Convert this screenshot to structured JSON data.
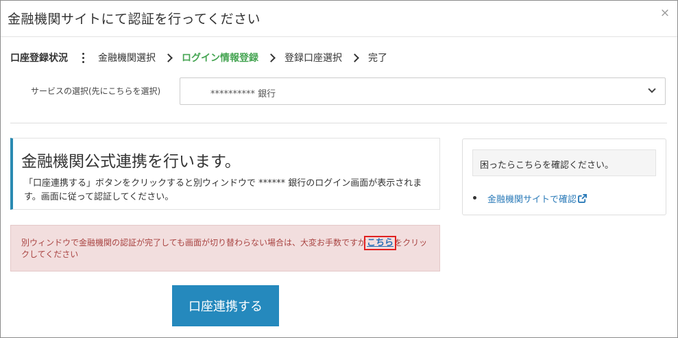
{
  "dialog": {
    "title": "金融機関サイトにて認証を行ってください",
    "close_glyph": "×"
  },
  "steps": {
    "label": "口座登録状況",
    "items": [
      {
        "label": "金融機関選択",
        "active": false
      },
      {
        "label": "ログイン情報登録",
        "active": true
      },
      {
        "label": "登録口座選択",
        "active": false
      },
      {
        "label": "完了",
        "active": false
      }
    ]
  },
  "service": {
    "label": "サービスの選択(先にこちらを選択)",
    "selected": "********** 銀行"
  },
  "info": {
    "title": "金融機関公式連携を行います。",
    "desc": "「口座連携する」ボタンをクリックすると別ウィンドウで ****** 銀行のログイン画面が表示されます。画面に従って認証してください。"
  },
  "alert": {
    "before": "別ウィンドウで金融機関の認証が完了しても画面が切り替わらない場合は、大変お手数ですが",
    "link": "こちら",
    "after": "をクリックしてください"
  },
  "connect_button": "口座連携する",
  "help": {
    "title": "困ったらこちらを確認ください。",
    "link": "金融機関サイトで確認"
  },
  "colors": {
    "accent": "#2589bd",
    "active_step": "#46a553",
    "alert_bg": "#f2dede",
    "alert_text": "#a94442",
    "highlight_box": "#e02020"
  }
}
